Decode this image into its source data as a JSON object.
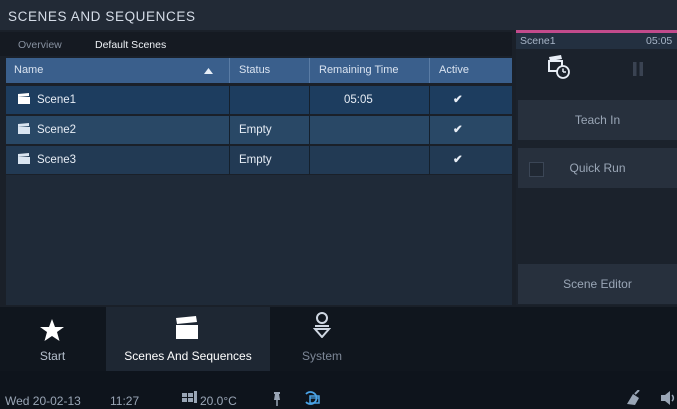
{
  "app": {
    "title": "SCENES AND SEQUENCES"
  },
  "tabs": [
    {
      "label": "Overview"
    },
    {
      "label": "Default Scenes"
    }
  ],
  "table": {
    "columns": [
      "Name",
      "Status",
      "Remaining Time",
      "Active"
    ],
    "rows": [
      {
        "name": "Scene1",
        "status": "",
        "remaining": "05:05",
        "active": "✔"
      },
      {
        "name": "Scene2",
        "status": "Empty",
        "remaining": "",
        "active": "✔"
      },
      {
        "name": "Scene3",
        "status": "Empty",
        "remaining": "",
        "active": "✔"
      }
    ]
  },
  "scene_panel": {
    "name": "Scene1",
    "time": "05:05",
    "buttons": {
      "teach": "Teach In",
      "quick": "Quick Run",
      "editor": "Scene Editor"
    }
  },
  "nav": [
    {
      "label": "Start",
      "icon": "star-icon"
    },
    {
      "label": "Scenes And Sequences",
      "icon": "clapperboard-icon"
    },
    {
      "label": "System",
      "icon": "system-icon"
    }
  ],
  "status": {
    "date": "Wed 20-02-13",
    "time": "11:27",
    "temp": "20.0°C"
  },
  "colors": {
    "header_blue": "#3a5f8c",
    "accent_pink": "#c24b8c",
    "selected_row": "#1d3d5f"
  }
}
